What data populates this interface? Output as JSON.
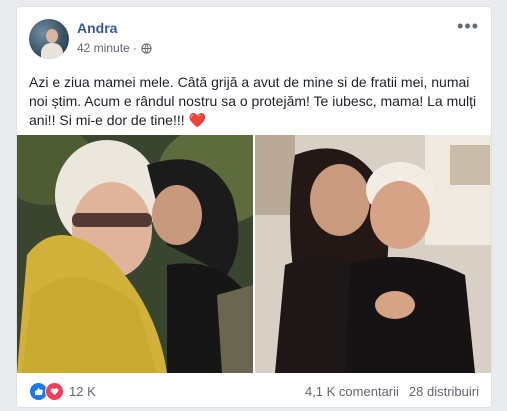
{
  "post": {
    "author": "Andra",
    "time": "42 minute ·",
    "more_label": "•••",
    "text_main": "Azi e ziua mamei mele. Câtă grijă a avut de mine si de fratii mei, numai noi știm. Acum e rândul nostru sa o protejăm! Te iubesc, mama! La mulți ani!! Si mi-e dor de tine!!!",
    "text_heart": "❤️",
    "likes": "12 K",
    "comments": "4,1 K comentarii",
    "shares": "28 distribuiri",
    "icons": [
      "globe-icon",
      "like-reaction-icon",
      "love-reaction-icon",
      "more-options-icon"
    ],
    "colors": {
      "author": "#385898",
      "like": "#1877f2",
      "love": "#f33e58"
    }
  }
}
